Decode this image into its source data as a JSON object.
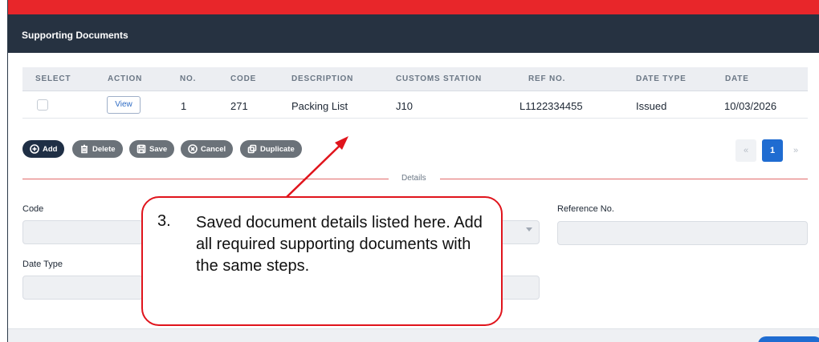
{
  "header": {
    "title": "Supporting Documents"
  },
  "table": {
    "columns": [
      "SELECT",
      "ACTION",
      "NO.",
      "CODE",
      "DESCRIPTION",
      "CUSTOMS STATION",
      "REF NO.",
      "DATE TYPE",
      "DATE"
    ],
    "rows": [
      {
        "action": "View",
        "no": "1",
        "code": "271",
        "description": "Packing List",
        "customs_station": "J10",
        "ref_no": "L1122334455",
        "date_type": "Issued",
        "date": "10/03/2026"
      }
    ]
  },
  "toolbar": {
    "add": "Add",
    "delete": "Delete",
    "save": "Save",
    "cancel": "Cancel",
    "duplicate": "Duplicate"
  },
  "pager": {
    "prev": "«",
    "page": "1",
    "next": "»"
  },
  "details": {
    "section_label": "Details",
    "code_label": "Code",
    "reference_label": "Reference No.",
    "date_type_label": "Date Type"
  },
  "callout": {
    "number": "3.",
    "text": "Saved document details listed here. Add all required supporting documents with the same steps."
  },
  "colors": {
    "accent_red": "#e8262a",
    "header_dark": "#263241",
    "primary_blue": "#1f6cd1"
  },
  "icons": {
    "add": "plus-circle-icon",
    "delete": "trash-icon",
    "save": "floppy-icon",
    "cancel": "x-circle-icon",
    "duplicate": "copy-icon"
  }
}
